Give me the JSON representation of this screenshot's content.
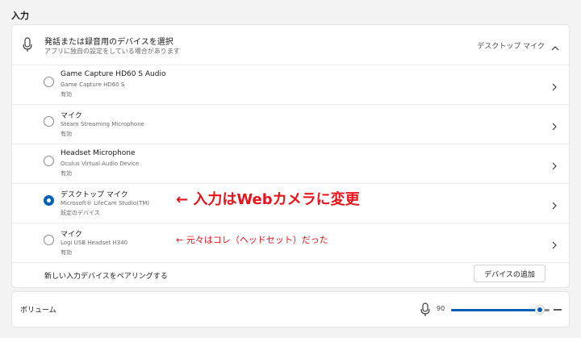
{
  "section": {
    "title": "入力"
  },
  "header": {
    "title": "発話または録音用のデバイスを選択",
    "subtitle": "アプリに独自の設定をしている場合があります",
    "selected_value": "デスクトップ マイク"
  },
  "devices": [
    {
      "name": "Game Capture HD60 S Audio",
      "subtitle": "Game Capture HD60 S",
      "status": "有効",
      "selected": false
    },
    {
      "name": "マイク",
      "subtitle": "Steam Streaming Microphone",
      "status": "有効",
      "selected": false
    },
    {
      "name": "Headset Microphone",
      "subtitle": "Oculus Virtual Audio Device",
      "status": "有効",
      "selected": false
    },
    {
      "name": "デスクトップ マイク",
      "subtitle": "Microsoft® LifeCam Studio(TM)",
      "status": "既定のデバイス",
      "selected": true
    },
    {
      "name": "マイク",
      "subtitle": "Logi USB Headset H340",
      "status": "有効",
      "selected": false
    }
  ],
  "annotations": {
    "big": "← 入力はWebカメラに変更",
    "small": "← 元々はコレ（ヘッドセット）だった"
  },
  "pairing": {
    "text": "新しい入力デバイスをペアリングする",
    "button_label": "デバイスの追加"
  },
  "volume": {
    "label": "ボリューム",
    "value": "90",
    "level_percent": 90
  },
  "colors": {
    "accent": "#005fb8",
    "annotation": "#e8141b",
    "background": "#f3f3f3",
    "card": "#ffffff"
  }
}
